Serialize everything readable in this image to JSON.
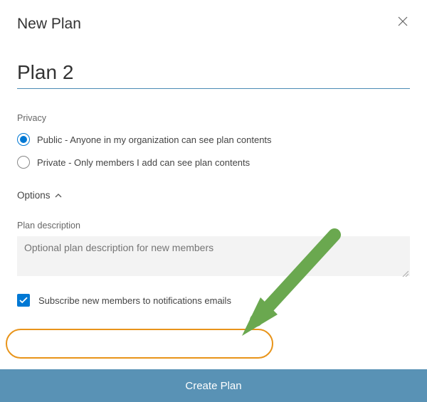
{
  "dialog": {
    "title": "New Plan",
    "plan_name_value": "Plan 2"
  },
  "privacy": {
    "section_label": "Privacy",
    "public_label": "Public - Anyone in my organization can see plan contents",
    "private_label": "Private - Only members I add can see plan contents",
    "selected": "public"
  },
  "options": {
    "toggle_label": "Options",
    "expanded": true
  },
  "description": {
    "label": "Plan description",
    "placeholder": "Optional plan description for new members",
    "value": ""
  },
  "subscribe": {
    "label": "Subscribe new members to notifications emails",
    "checked": true
  },
  "footer": {
    "create_label": "Create Plan"
  }
}
